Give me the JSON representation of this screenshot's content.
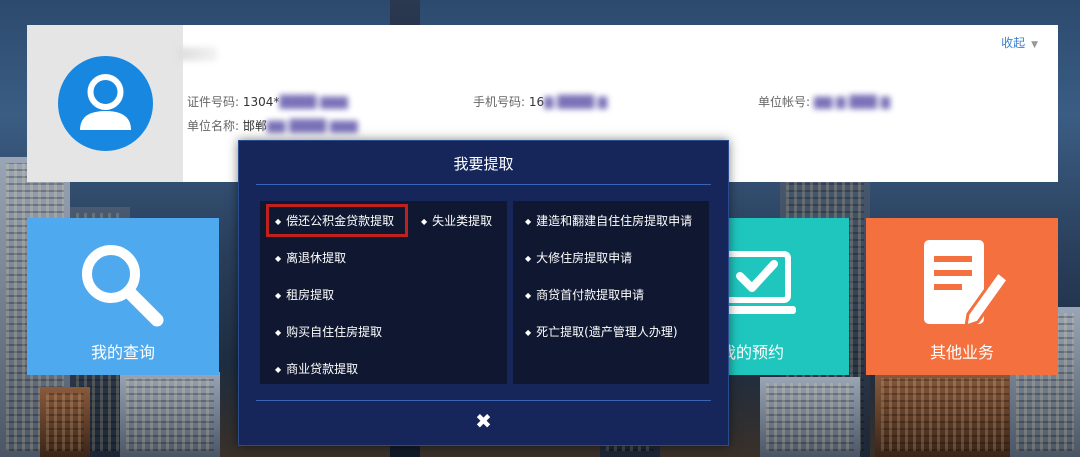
{
  "profile": {
    "collapse_label": "收起",
    "id_label": "证件号码:",
    "id_value_visible": "1304*",
    "phone_label": "手机号码:",
    "phone_value_visible": "16",
    "unit_account_label": "单位帐号:",
    "unit_name_label": "单位名称:",
    "unit_name_value_visible": "邯郸"
  },
  "tiles": {
    "query_label": "我的查询",
    "appointment_label": "我的预约",
    "other_label": "其他业务"
  },
  "modal": {
    "title": "我要提取",
    "left_items": [
      "偿还公积金贷款提取",
      "离退休提取",
      "租房提取",
      "购买自住住房提取",
      "商业贷款提取"
    ],
    "middle_items": [
      "失业类提取"
    ],
    "right_items": [
      "建造和翻建自住住房提取申请",
      "大修住房提取申请",
      "商贷首付款提取申请",
      "死亡提取(遗产管理人办理)"
    ],
    "close_symbol": "✖"
  },
  "colors": {
    "modal_bg": "#16265a",
    "highlight": "#c0211d",
    "avatar": "#1887e0",
    "tile_query": "#4fa9ee",
    "tile_appointment": "#1fc6bd",
    "tile_other": "#f4703e"
  }
}
